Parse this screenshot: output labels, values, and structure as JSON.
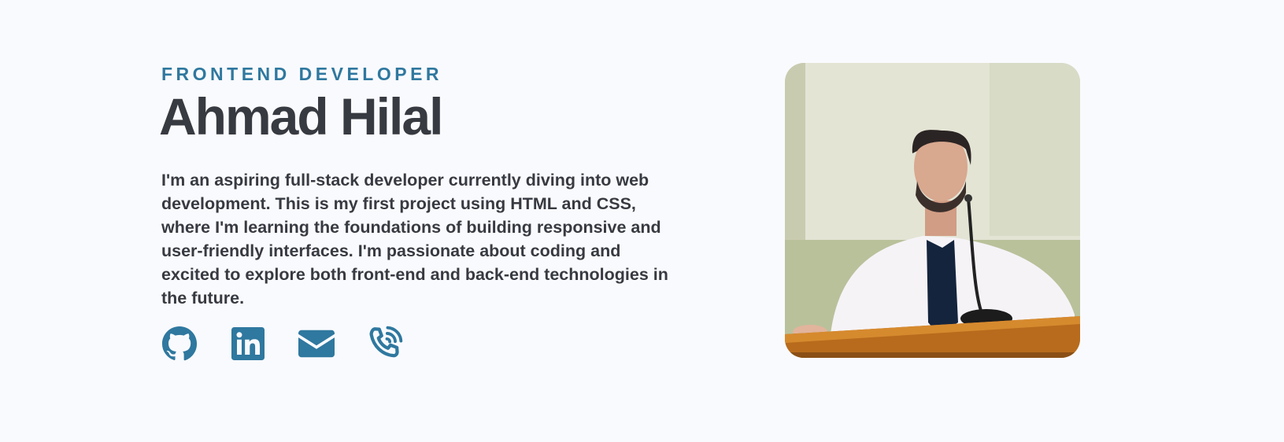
{
  "hero": {
    "role": "FRONTEND DEVELOPER",
    "name": "Ahmad Hilal",
    "bio": "I'm an aspiring full-stack developer currently diving into web development. This is my first project using HTML and CSS, where I'm learning the foundations of building responsive and user-friendly interfaces. I'm passionate about coding and excited to explore both front-end and back-end technologies in the future."
  },
  "socials": [
    {
      "icon": "github-icon"
    },
    {
      "icon": "linkedin-icon"
    },
    {
      "icon": "envelope-icon"
    },
    {
      "icon": "phone-icon"
    }
  ],
  "colors": {
    "accent": "#2f789f",
    "text": "#373a40",
    "background": "#f9fafe"
  },
  "photo": {
    "subject": "portrait-photo"
  }
}
